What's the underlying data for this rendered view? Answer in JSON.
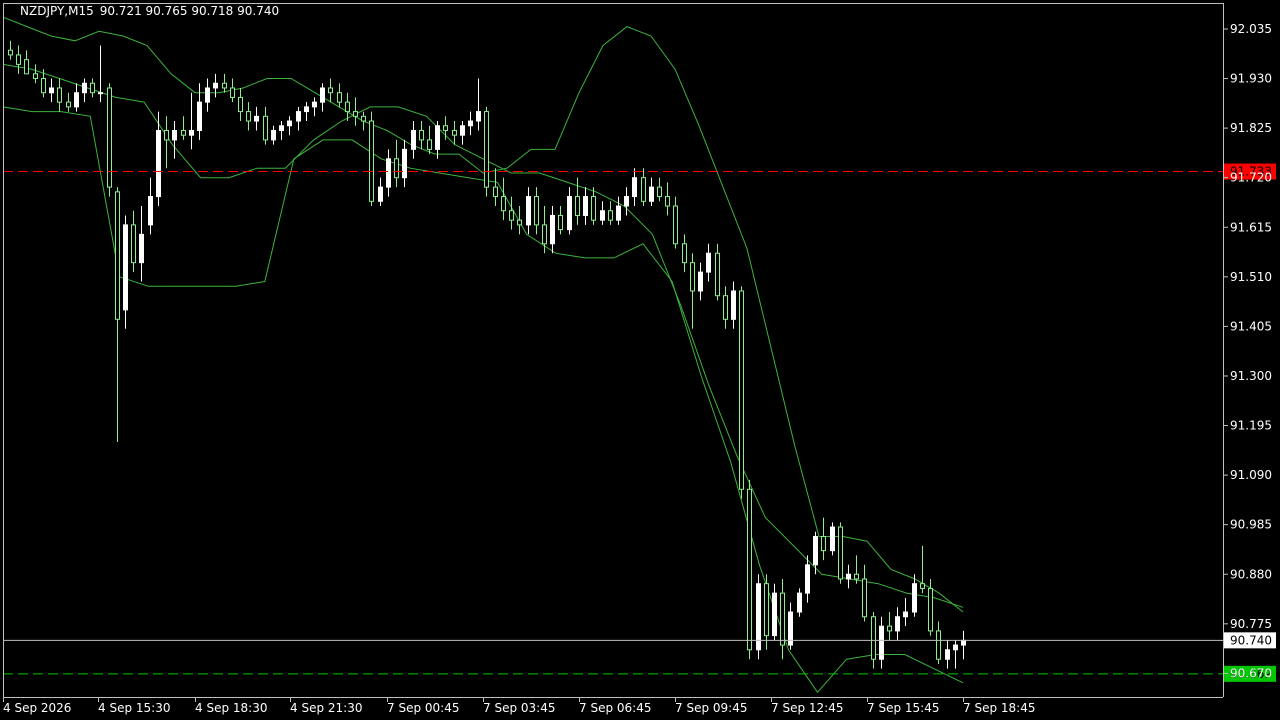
{
  "header": {
    "symbol": "NZDJPY,M15",
    "ohlc": "90.721 90.765 90.718 90.740"
  },
  "colors": {
    "background": "#000000",
    "axis": "#c0c0c0",
    "text": "#ffffff",
    "bull": "#ffffff",
    "bear": "#90ee90",
    "bands": "#3cb43c",
    "line_red": "#ff0000",
    "line_green": "#00c800",
    "bid": "#c0c0c0"
  },
  "chart_data": {
    "type": "candlestick",
    "symbol": "NZDJPY",
    "timeframe": "M15",
    "ylim": [
      90.62,
      92.09
    ],
    "y_ticks": [
      "92.035",
      "91.930",
      "91.825",
      "91.720",
      "91.615",
      "91.510",
      "91.405",
      "91.300",
      "91.195",
      "91.090",
      "90.985",
      "90.880",
      "90.775",
      "90.670"
    ],
    "x_labels": [
      "4 Sep 2026",
      "4 Sep 15:30",
      "4 Sep 18:30",
      "4 Sep 21:30",
      "7 Sep 00:45",
      "7 Sep 03:45",
      "7 Sep 06:45",
      "7 Sep 09:45",
      "7 Sep 12:45",
      "7 Sep 15:45",
      "7 Sep 18:45"
    ],
    "horizontal_lines": [
      {
        "name": "resistance",
        "value": "91.733",
        "color": "#ff0000"
      },
      {
        "name": "support",
        "value": "90.669",
        "color": "#00c800"
      }
    ],
    "current_price": "90.740",
    "candles": [
      [
        91.99,
        92.01,
        91.97,
        91.98
      ],
      [
        91.98,
        92.0,
        91.94,
        91.96
      ],
      [
        91.97,
        91.99,
        91.94,
        91.94
      ],
      [
        91.94,
        91.96,
        91.92,
        91.93
      ],
      [
        91.93,
        91.95,
        91.89,
        91.9
      ],
      [
        91.9,
        91.93,
        91.88,
        91.91
      ],
      [
        91.91,
        91.93,
        91.86,
        91.88
      ],
      [
        91.88,
        91.9,
        91.86,
        91.87
      ],
      [
        91.87,
        91.92,
        91.86,
        91.9
      ],
      [
        91.9,
        91.93,
        91.88,
        91.92
      ],
      [
        91.92,
        91.93,
        91.89,
        91.9
      ],
      [
        91.9,
        92.0,
        91.88,
        91.9
      ],
      [
        91.91,
        91.92,
        91.68,
        91.7
      ],
      [
        91.69,
        91.7,
        91.16,
        91.42
      ],
      [
        91.44,
        91.64,
        91.4,
        91.62
      ],
      [
        91.62,
        91.65,
        91.52,
        91.54
      ],
      [
        91.54,
        91.66,
        91.5,
        91.6
      ],
      [
        91.62,
        91.72,
        91.6,
        91.68
      ],
      [
        91.68,
        91.86,
        91.66,
        91.82
      ],
      [
        91.82,
        91.85,
        91.74,
        91.8
      ],
      [
        91.8,
        91.84,
        91.76,
        91.82
      ],
      [
        91.82,
        91.85,
        91.8,
        91.81
      ],
      [
        91.81,
        91.9,
        91.78,
        91.82
      ],
      [
        91.82,
        91.92,
        91.8,
        91.88
      ],
      [
        91.88,
        91.93,
        91.86,
        91.91
      ],
      [
        91.91,
        91.94,
        91.89,
        91.92
      ],
      [
        91.92,
        91.94,
        91.9,
        91.91
      ],
      [
        91.91,
        91.93,
        91.88,
        91.89
      ],
      [
        91.89,
        91.91,
        91.84,
        91.86
      ],
      [
        91.86,
        91.88,
        91.82,
        91.84
      ],
      [
        91.84,
        91.87,
        91.82,
        91.85
      ],
      [
        91.85,
        91.87,
        91.79,
        91.8
      ],
      [
        91.8,
        91.83,
        91.79,
        91.82
      ],
      [
        91.82,
        91.84,
        91.8,
        91.83
      ],
      [
        91.83,
        91.85,
        91.81,
        91.84
      ],
      [
        91.84,
        91.87,
        91.82,
        91.86
      ],
      [
        91.86,
        91.88,
        91.84,
        91.87
      ],
      [
        91.87,
        91.89,
        91.85,
        91.88
      ],
      [
        91.88,
        91.92,
        91.86,
        91.91
      ],
      [
        91.91,
        91.93,
        91.88,
        91.9
      ],
      [
        91.9,
        91.92,
        91.87,
        91.88
      ],
      [
        91.88,
        91.9,
        91.84,
        91.86
      ],
      [
        91.86,
        91.89,
        91.83,
        91.85
      ],
      [
        91.85,
        91.86,
        91.82,
        91.84
      ],
      [
        91.84,
        91.86,
        91.66,
        91.67
      ],
      [
        91.67,
        91.72,
        91.66,
        91.7
      ],
      [
        91.7,
        91.78,
        91.68,
        91.76
      ],
      [
        91.76,
        91.8,
        91.7,
        91.72
      ],
      [
        91.72,
        91.8,
        91.7,
        91.78
      ],
      [
        91.78,
        91.84,
        91.76,
        91.82
      ],
      [
        91.82,
        91.84,
        91.78,
        91.8
      ],
      [
        91.8,
        91.83,
        91.77,
        91.78
      ],
      [
        91.78,
        91.84,
        91.76,
        91.83
      ],
      [
        91.83,
        91.85,
        91.8,
        91.82
      ],
      [
        91.82,
        91.84,
        91.79,
        91.81
      ],
      [
        91.81,
        91.84,
        91.79,
        91.83
      ],
      [
        91.83,
        91.86,
        91.81,
        91.84
      ],
      [
        91.84,
        91.93,
        91.82,
        91.86
      ],
      [
        91.86,
        91.87,
        91.68,
        91.7
      ],
      [
        91.7,
        91.74,
        91.66,
        91.68
      ],
      [
        91.68,
        91.72,
        91.63,
        91.65
      ],
      [
        91.65,
        91.68,
        91.61,
        91.63
      ],
      [
        91.63,
        91.66,
        91.6,
        91.62
      ],
      [
        91.62,
        91.7,
        91.6,
        91.68
      ],
      [
        91.68,
        91.7,
        91.6,
        91.62
      ],
      [
        91.62,
        91.66,
        91.56,
        91.58
      ],
      [
        91.58,
        91.66,
        91.56,
        91.64
      ],
      [
        91.64,
        91.66,
        91.6,
        91.61
      ],
      [
        91.61,
        91.7,
        91.6,
        91.68
      ],
      [
        91.68,
        91.72,
        91.62,
        91.64
      ],
      [
        91.64,
        91.7,
        91.62,
        91.68
      ],
      [
        91.68,
        91.7,
        91.62,
        91.63
      ],
      [
        91.63,
        91.67,
        91.62,
        91.65
      ],
      [
        91.65,
        91.67,
        91.62,
        91.63
      ],
      [
        91.63,
        91.68,
        91.62,
        91.66
      ],
      [
        91.66,
        91.7,
        91.64,
        91.68
      ],
      [
        91.68,
        91.74,
        91.66,
        91.72
      ],
      [
        91.72,
        91.74,
        91.66,
        91.67
      ],
      [
        91.67,
        91.72,
        91.66,
        91.7
      ],
      [
        91.7,
        91.72,
        91.67,
        91.68
      ],
      [
        91.68,
        91.71,
        91.64,
        91.66
      ],
      [
        91.66,
        91.68,
        91.57,
        91.58
      ],
      [
        91.58,
        91.6,
        91.52,
        91.54
      ],
      [
        91.54,
        91.56,
        91.4,
        91.48
      ],
      [
        91.48,
        91.54,
        91.46,
        91.52
      ],
      [
        91.52,
        91.58,
        91.5,
        91.56
      ],
      [
        91.56,
        91.58,
        91.46,
        91.47
      ],
      [
        91.47,
        91.49,
        91.4,
        91.42
      ],
      [
        91.42,
        91.5,
        91.4,
        91.48
      ],
      [
        91.48,
        91.49,
        91.04,
        91.06
      ],
      [
        91.06,
        91.08,
        90.7,
        90.72
      ],
      [
        90.72,
        90.88,
        90.7,
        90.86
      ],
      [
        90.86,
        90.88,
        90.72,
        90.75
      ],
      [
        90.75,
        90.86,
        90.74,
        90.84
      ],
      [
        90.84,
        90.87,
        90.7,
        90.73
      ],
      [
        90.73,
        90.82,
        90.72,
        90.8
      ],
      [
        90.8,
        90.85,
        90.79,
        90.84
      ],
      [
        90.84,
        90.92,
        90.82,
        90.9
      ],
      [
        90.9,
        90.97,
        90.88,
        90.96
      ],
      [
        90.96,
        91.0,
        90.91,
        90.93
      ],
      [
        90.93,
        90.99,
        90.92,
        90.98
      ],
      [
        90.98,
        90.99,
        90.86,
        90.87
      ],
      [
        90.87,
        90.9,
        90.85,
        90.88
      ],
      [
        90.88,
        90.92,
        90.86,
        90.87
      ],
      [
        90.87,
        90.9,
        90.78,
        90.79
      ],
      [
        90.79,
        90.8,
        90.68,
        90.7
      ],
      [
        90.7,
        90.79,
        90.68,
        90.77
      ],
      [
        90.77,
        90.8,
        90.74,
        90.76
      ],
      [
        90.76,
        90.81,
        90.74,
        90.79
      ],
      [
        90.79,
        90.83,
        90.77,
        90.8
      ],
      [
        90.8,
        90.88,
        90.79,
        90.86
      ],
      [
        90.86,
        90.94,
        90.84,
        90.85
      ],
      [
        90.85,
        90.87,
        90.75,
        90.76
      ],
      [
        90.76,
        90.78,
        90.69,
        90.7
      ],
      [
        90.7,
        90.74,
        90.68,
        90.72
      ],
      [
        90.72,
        90.74,
        90.68,
        90.73
      ],
      [
        90.73,
        90.76,
        90.7,
        90.74
      ]
    ],
    "bollinger_bands": {
      "upper": [
        92.06,
        92.04,
        92.02,
        92.01,
        92.03,
        92.02,
        92.0,
        91.94,
        91.9,
        91.9,
        91.91,
        91.93,
        91.93,
        91.9,
        91.87,
        91.84,
        91.82,
        91.79,
        91.77,
        91.77,
        91.73,
        91.74,
        91.78,
        91.78,
        91.9,
        92.0,
        92.04,
        92.02,
        91.95,
        91.83,
        91.7,
        91.57,
        91.36,
        91.15,
        90.96,
        90.96,
        90.95,
        90.89,
        90.87,
        90.84,
        90.8
      ],
      "middle": [
        91.96,
        91.95,
        91.93,
        91.91,
        91.89,
        91.88,
        91.79,
        91.72,
        91.72,
        91.74,
        91.74,
        91.8,
        91.84,
        91.87,
        91.87,
        91.85,
        91.79,
        91.76,
        91.73,
        91.73,
        91.71,
        91.69,
        91.66,
        91.6,
        91.45,
        91.28,
        91.13,
        91.0,
        90.94,
        90.88,
        90.87,
        90.86,
        90.84,
        90.83,
        90.81
      ],
      "lower": [
        91.87,
        91.86,
        91.86,
        91.85,
        91.51,
        91.49,
        91.49,
        91.49,
        91.49,
        91.5,
        91.76,
        91.8,
        91.8,
        91.76,
        91.74,
        91.73,
        91.72,
        91.71,
        91.6,
        91.56,
        91.55,
        91.55,
        91.58,
        91.5,
        91.3,
        91.12,
        90.9,
        90.72,
        90.63,
        90.7,
        90.71,
        90.71,
        90.68,
        90.65
      ]
    }
  }
}
